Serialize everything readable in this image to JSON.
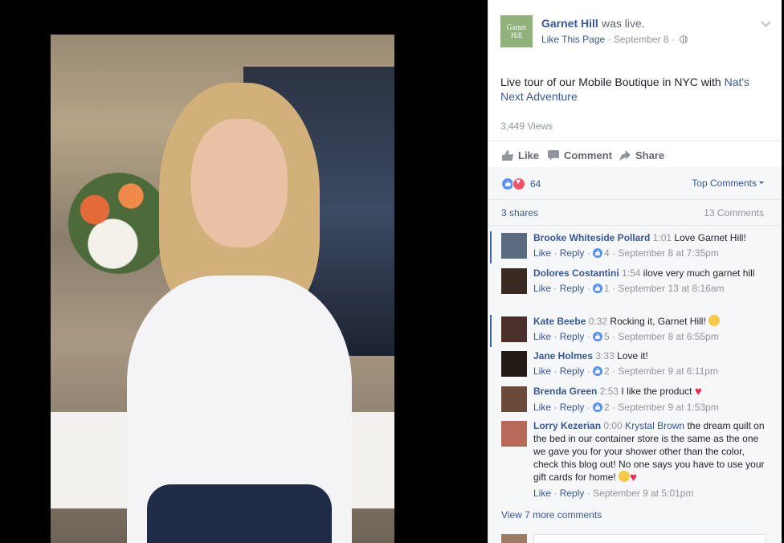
{
  "video": {
    "logo_text": "Garnet Hill"
  },
  "post": {
    "page_name": "Garnet Hill",
    "status": "was live.",
    "like_page": "Like This Page",
    "date": "· September 8 ·",
    "text_main": "Live tour of our Mobile Boutique in NYC with ",
    "text_link": "Nat's Next Adventure",
    "views": "3,449 Views",
    "actions": {
      "like": "Like",
      "comment": "Comment",
      "share": "Share"
    }
  },
  "feedback": {
    "reaction_count": "64",
    "sort_label": "Top Comments",
    "shares": "3 shares",
    "comment_count": "13 Comments",
    "view_more": "View 7 more comments"
  },
  "comments": [
    {
      "name": "Brooke Whiteside Pollard",
      "time": "1:01",
      "text": "Love Garnet Hill!",
      "like": "Like",
      "reply": "Reply",
      "likes": "4",
      "date": "September 8 at 7:35pm",
      "avatar_color": "#5b6a7e"
    },
    {
      "name": "Dolores Costantini",
      "time": "1:54",
      "text": "ilove very much garnet hill",
      "like": "Like",
      "reply": "Reply",
      "likes": "1",
      "date": "September 13 at 8:16am",
      "avatar_color": "#3a2a22"
    },
    {
      "name": "Kate Beebe",
      "time": "0:32",
      "text": "Rocking it, Garnet Hill!",
      "like": "Like",
      "reply": "Reply",
      "likes": "5",
      "date": "September 8 at 6:55pm",
      "avatar_color": "#4a2f2a"
    },
    {
      "name": "Jane Holmes",
      "time": "3:33",
      "text": "Love it!",
      "like": "Like",
      "reply": "Reply",
      "likes": "2",
      "date": "September 9 at 6:11pm",
      "avatar_color": "#241a16"
    },
    {
      "name": "Brenda Green",
      "time": "2:53",
      "text": "I like the product",
      "like": "Like",
      "reply": "Reply",
      "likes": "2",
      "date": "September 9 at 1:53pm",
      "avatar_color": "#6a4a3a"
    },
    {
      "name": "Lorry Kezerian",
      "time": "0:00",
      "mention": "Krystal Brown",
      "text": " the dream quilt on the bed in our container store is the same as the one we gave you for your shower other than the color, check this blog out! No one says you have to use your gift cards for home!",
      "like": "Like",
      "reply": "Reply",
      "date": "September 9 at 5:01pm",
      "avatar_color": "#b76a5a"
    }
  ]
}
